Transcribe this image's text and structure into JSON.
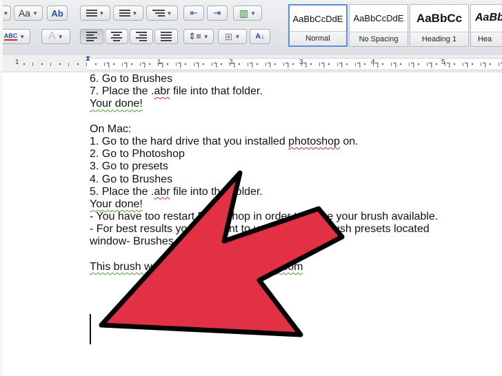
{
  "toolbar": {
    "font_size_glyph": "Aa",
    "clear_format_glyph": "Ab",
    "spell_glyph": "ABC",
    "text_effect_glyph": "A"
  },
  "styles": [
    {
      "sample": "AaBbCcDdE",
      "name": "Normal"
    },
    {
      "sample": "AaBbCcDdE",
      "name": "No Spacing"
    },
    {
      "sample": "AaBbCc",
      "name": "Heading 1"
    },
    {
      "sample": "AaBb",
      "name": "Hea"
    }
  ],
  "ruler": {
    "numbers": [
      "1",
      "1",
      "2",
      "3",
      "4",
      "5"
    ]
  },
  "document": {
    "lines": [
      {
        "segments": [
          {
            "t": "6. Go to Brushes"
          }
        ]
      },
      {
        "segments": [
          {
            "t": "7. Place the ."
          },
          {
            "t": "abr",
            "err": "spell"
          },
          {
            "t": " file into that folder."
          }
        ]
      },
      {
        "segments": [
          {
            "t": "Your done!",
            "err": "grammar"
          }
        ]
      },
      {
        "segments": []
      },
      {
        "segments": [
          {
            "t": "On Mac:"
          }
        ]
      },
      {
        "segments": [
          {
            "t": "1. Go to the hard drive that you installed "
          },
          {
            "t": "photoshop",
            "err": "spell"
          },
          {
            "t": " on."
          }
        ]
      },
      {
        "segments": [
          {
            "t": "2. Go to Photoshop"
          }
        ]
      },
      {
        "segments": [
          {
            "t": "3. Go to presets"
          }
        ]
      },
      {
        "segments": [
          {
            "t": "4. Go to Brushes"
          }
        ]
      },
      {
        "segments": [
          {
            "t": "5. Place the ."
          },
          {
            "t": "abr",
            "err": "spell"
          },
          {
            "t": " file into that folder."
          }
        ]
      },
      {
        "segments": [
          {
            "t": "Your done!",
            "err": "grammar"
          }
        ]
      },
      {
        "segments": [
          {
            "t": "- You have too restart Photoshop in order to make your brush available."
          }
        ]
      },
      {
        "segments": [
          {
            "t": "- For best results you will want to use it with the brush presets located"
          }
        ]
      },
      {
        "segments": [
          {
            "t": "window- Brushes"
          }
        ]
      },
      {
        "segments": []
      },
      {
        "segments": [
          {
            "t": "This brush was made by ",
            "err": "grammar"
          },
          {
            "t": "me.deviantart.com",
            "err": "grammar"
          }
        ]
      }
    ]
  },
  "overlay": {
    "arrow_fill": "#e23045",
    "arrow_stroke": "#000000"
  }
}
